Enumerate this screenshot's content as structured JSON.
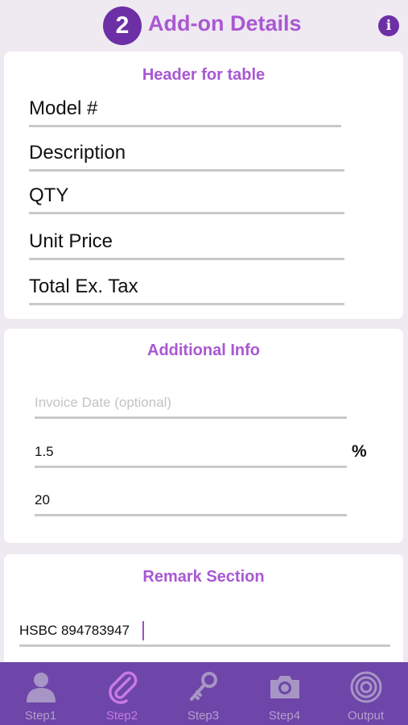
{
  "header": {
    "step_number": "2",
    "title": "Add-on Details",
    "info_glyph": "i"
  },
  "table_header": {
    "title": "Header for table",
    "fields": [
      {
        "value": "Model #"
      },
      {
        "value": "Description"
      },
      {
        "value": "QTY"
      },
      {
        "value": "Unit Price"
      },
      {
        "value": "Total Ex. Tax"
      }
    ]
  },
  "additional_info": {
    "title": "Additional Info",
    "invoice_date": {
      "value": "",
      "placeholder": "Invoice Date (optional)"
    },
    "percent": {
      "value": "1.5",
      "unit": "%"
    },
    "amount": {
      "value": "20"
    }
  },
  "remark": {
    "title": "Remark Section",
    "value": "HSBC 894783947"
  },
  "tabbar": {
    "tabs": [
      {
        "label": "Step1",
        "icon": "person-icon",
        "active": false
      },
      {
        "label": "Step2",
        "icon": "paperclip-icon",
        "active": true
      },
      {
        "label": "Step3",
        "icon": "key-icon",
        "active": false
      },
      {
        "label": "Step4",
        "icon": "camera-icon",
        "active": false
      },
      {
        "label": "Output",
        "icon": "target-icon",
        "active": false
      }
    ]
  },
  "colors": {
    "accent": "#a958d3",
    "badge": "#6c2fa6",
    "tabbar_bg": "#6e45a8",
    "tab_inactive": "#b3a1cd",
    "tab_active": "#c77ae6"
  }
}
